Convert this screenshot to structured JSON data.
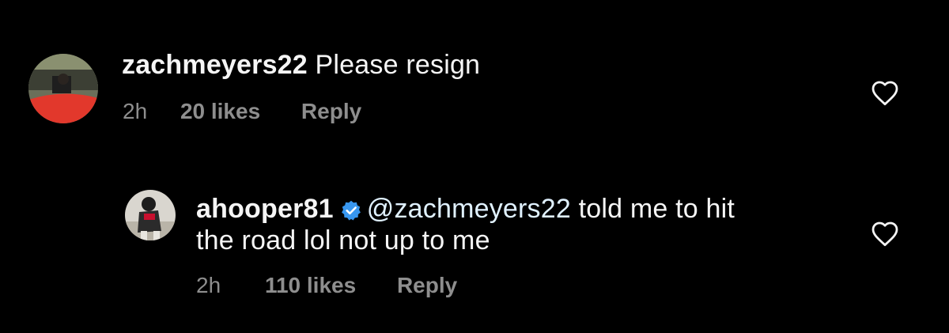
{
  "comments": [
    {
      "username": "zachmeyers22",
      "text": " Please resign",
      "time": "2h",
      "likes": "20 likes",
      "reply": "Reply"
    },
    {
      "username": "ahooper81",
      "verified": true,
      "mention": "@zachmeyers22",
      "text_line1": " told me to hit",
      "text_line2": "the road lol not up to me",
      "time": "2h",
      "likes": "110 likes",
      "reply": "Reply"
    }
  ],
  "icons": {
    "like": "heart-outline-icon",
    "verified": "verified-badge-icon"
  },
  "colors": {
    "background": "#000000",
    "text": "#f5f5f5",
    "secondary": "#8e8e8e",
    "verified": "#3897f0"
  }
}
